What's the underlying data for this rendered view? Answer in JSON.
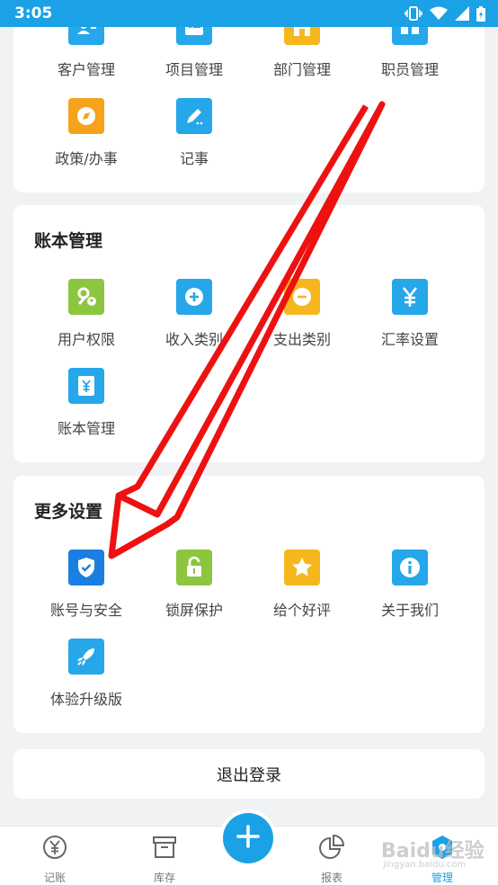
{
  "status_bar": {
    "time": "3:05"
  },
  "card1": {
    "items": [
      {
        "label": "客户管理",
        "icon": "user-card-icon",
        "color": "#25a7ea"
      },
      {
        "label": "项目管理",
        "icon": "list-icon",
        "color": "#25a7ea"
      },
      {
        "label": "部门管理",
        "icon": "building-icon",
        "color": "#f6b71e"
      },
      {
        "label": "职员管理",
        "icon": "staff-icon",
        "color": "#25a7ea"
      },
      {
        "label": "政策/办事",
        "icon": "compass-icon",
        "color": "#f7a21b"
      },
      {
        "label": "记事",
        "icon": "pen-icon",
        "color": "#25a7ea"
      }
    ]
  },
  "card2": {
    "title": "账本管理",
    "items": [
      {
        "label": "用户权限",
        "icon": "key-user-icon",
        "color": "#8cc63f"
      },
      {
        "label": "收入类别",
        "icon": "plus-circle-icon",
        "color": "#25a7ea"
      },
      {
        "label": "支出类别",
        "icon": "minus-circle-icon",
        "color": "#f6b71e"
      },
      {
        "label": "汇率设置",
        "icon": "yen-icon",
        "color": "#25a7ea"
      },
      {
        "label": "账本管理",
        "icon": "yen-book-icon",
        "color": "#25a7ea"
      }
    ]
  },
  "card3": {
    "title": "更多设置",
    "items": [
      {
        "label": "账号与安全",
        "icon": "shield-check-icon",
        "color": "#1a7fe0"
      },
      {
        "label": "锁屏保护",
        "icon": "lock-icon",
        "color": "#8cc63f"
      },
      {
        "label": "给个好评",
        "icon": "star-icon",
        "color": "#f6b71e"
      },
      {
        "label": "关于我们",
        "icon": "info-icon",
        "color": "#25a7ea"
      },
      {
        "label": "体验升级版",
        "icon": "rocket-icon",
        "color": "#25a7ea"
      }
    ]
  },
  "logout": {
    "label": "退出登录"
  },
  "bottom_nav": {
    "items": [
      {
        "label": "记账",
        "icon": "yen-circle-icon"
      },
      {
        "label": "库存",
        "icon": "archive-box-icon"
      },
      {
        "label": "报表",
        "icon": "pie-chart-icon"
      },
      {
        "label": "管理",
        "icon": "manage-icon",
        "active": true
      }
    ],
    "fab_icon": "plus-icon"
  },
  "watermark": {
    "text": "Baidu经验",
    "sub": "jingyan.baidu.com"
  },
  "colors": {
    "accent": "#1aa1e6",
    "arrow": "#ee1111",
    "background": "#f1f2f4"
  }
}
